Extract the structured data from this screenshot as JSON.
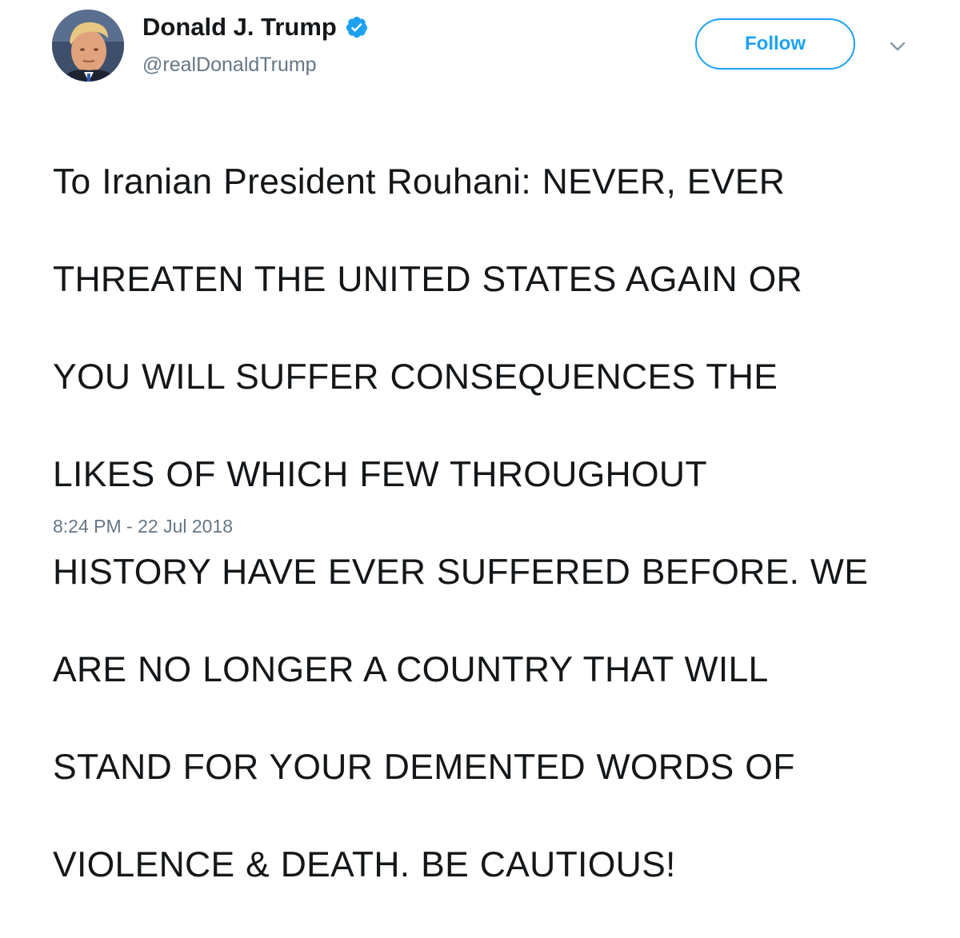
{
  "user": {
    "display_name": "Donald J. Trump",
    "handle": "@realDonaldTrump",
    "verified_icon": "verified-badge-icon",
    "avatar_icon": "profile-avatar"
  },
  "actions": {
    "follow_label": "Follow",
    "more_icon": "chevron-down-icon"
  },
  "tweet": {
    "lines": [
      "To Iranian President Rouhani: NEVER, EVER",
      "THREATEN THE UNITED STATES AGAIN OR",
      "YOU WILL SUFFER CONSEQUENCES THE",
      "LIKES OF WHICH FEW THROUGHOUT",
      "HISTORY HAVE EVER SUFFERED BEFORE. WE",
      "ARE NO LONGER A COUNTRY THAT WILL",
      "STAND FOR YOUR DEMENTED WORDS OF",
      "VIOLENCE & DEATH. BE CAUTIOUS!"
    ],
    "timestamp": "8:24 PM - 22 Jul 2018"
  },
  "colors": {
    "accent": "#1da1f2",
    "text": "#14171a",
    "secondary": "#657786"
  }
}
